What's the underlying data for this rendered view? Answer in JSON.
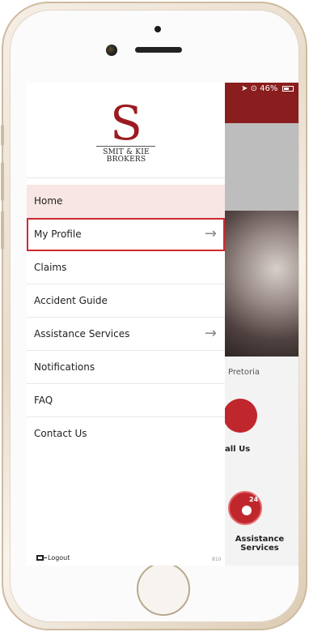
{
  "status_bar": {
    "battery": "46%"
  },
  "brand": {
    "initial": "S",
    "line1": "SMIT & KIE",
    "line2": "BROKERS"
  },
  "menu": [
    {
      "label": "Home",
      "state": "active"
    },
    {
      "label": "My Profile",
      "has_arrow": true,
      "highlighted": true
    },
    {
      "label": "Claims"
    },
    {
      "label": "Accident Guide"
    },
    {
      "label": "Assistance Services",
      "has_arrow": true
    },
    {
      "label": "Notifications"
    },
    {
      "label": "FAQ"
    },
    {
      "label": "Contact Us"
    }
  ],
  "footer": {
    "logout": "Logout",
    "version": "810"
  },
  "background": {
    "location": "Pretoria",
    "call": "all Us",
    "assist_line1": "Assistance",
    "assist_line2": "Services",
    "badge_24": "24"
  },
  "arrow_glyph": "→",
  "colors": {
    "brand_red": "#9b1b21",
    "header_red": "#8a1d1d",
    "active_bg": "#f8e6e4",
    "highlight_border": "#d02a31"
  }
}
